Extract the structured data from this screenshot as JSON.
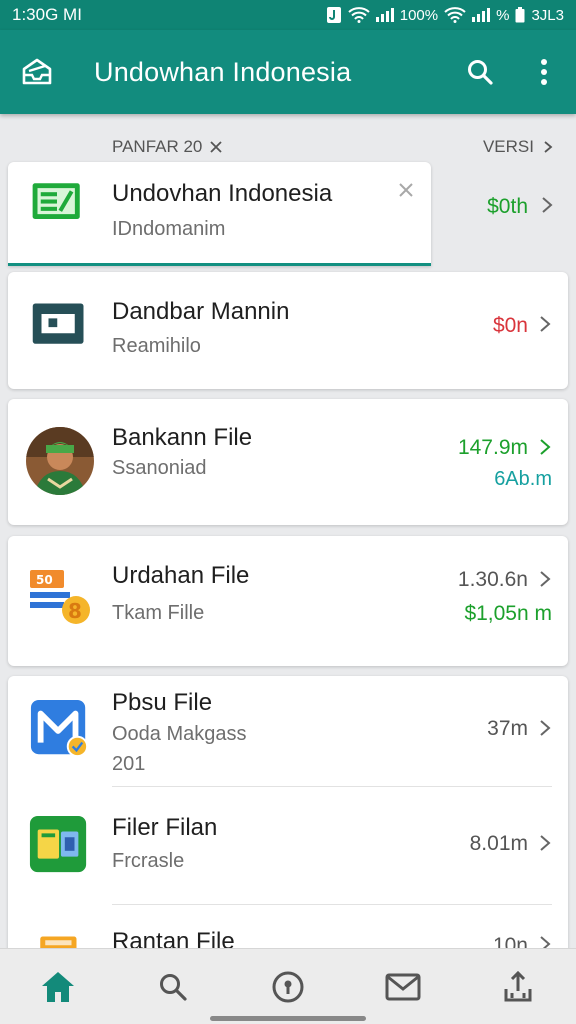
{
  "status": {
    "time": "1:30G MI",
    "battery_text": "100%",
    "percent_symbol": "%",
    "right_clock": "3JL3"
  },
  "app_bar": {
    "title": "Undowhan Indonesia",
    "brand_color": "#128c7e"
  },
  "filters": {
    "left_chip": "PANFAR 20",
    "right_label": "VERSI"
  },
  "items": [
    {
      "name": "Undovhan Indonesia",
      "sub": "IDndomanim",
      "amount": "$0th",
      "amount_color": "green",
      "icon": "document-green-icon"
    },
    {
      "name": "Dandbar Mannin",
      "sub": "Reamihilo",
      "amount": "$0n",
      "amount_color": "red",
      "icon": "screen-dark-icon"
    },
    {
      "name": "Bankann File",
      "sub": "Ssanoniad",
      "amount": "147.9m",
      "amount2": "6Ab.m",
      "amount_color": "green",
      "icon": "user-photo"
    },
    {
      "name": "Urdahan File",
      "sub": "Tkam Fille",
      "amount": "1.30.6n",
      "amount2": "$1,05n m",
      "amount_color": "gray",
      "icon": "cards-orange-icon",
      "icon_label": "50"
    },
    {
      "name": "Pbsu File",
      "sub": "Ooda Makgass",
      "sub2": "201",
      "amount": "37m",
      "amount_color": "gray",
      "icon": "m-blue-icon"
    },
    {
      "name": "Filer Filan",
      "sub": "Frcrasle",
      "amount": "8.01m",
      "amount_color": "gray",
      "icon": "cards-green-icon"
    },
    {
      "name": "Rantan File",
      "amount": "10n",
      "amount_color": "gray",
      "icon": "folder-orange-icon"
    }
  ],
  "bottom_nav": [
    "home-icon",
    "search-icon",
    "compass-icon",
    "mail-icon",
    "share-icon"
  ]
}
